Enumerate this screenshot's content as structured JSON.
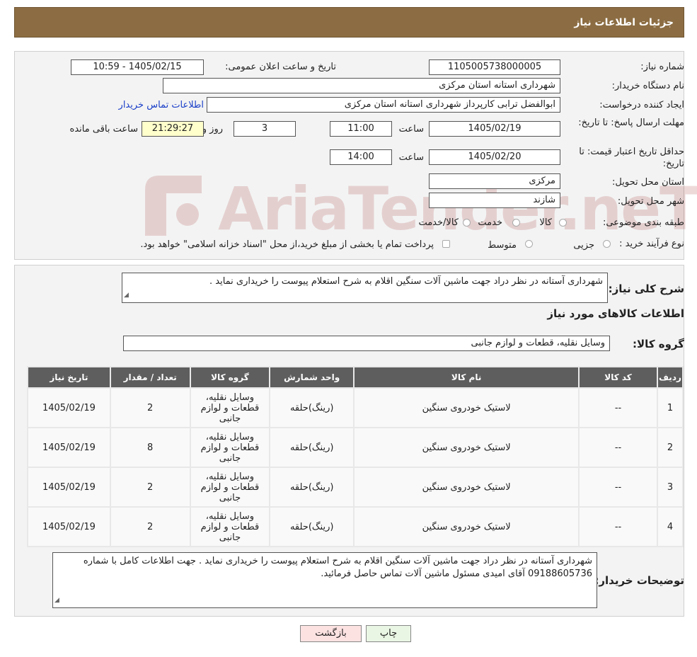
{
  "header": {
    "title": "جزئیات اطلاعات نیاز"
  },
  "form": {
    "need_number_label": "شماره نیاز:",
    "need_number": "1105005738000005",
    "announce_label": "تاریخ و ساعت اعلان عمومی:",
    "announce_value": "1405/02/15 - 10:59",
    "buyer_org_label": "نام دستگاه خریدار:",
    "buyer_org": "شهرداری استانه استان مرکزی",
    "creator_label": "ایجاد کننده درخواست:",
    "creator": "ابوالفضل  ترابی  کارپرداز  شهرداری استانه استان مرکزی",
    "contact_link": "اطلاعات تماس خریدار",
    "deadline_label": "مهلت ارسال پاسخ: تا تاریخ:",
    "deadline_date": "1405/02/19",
    "time_label": "ساعت",
    "deadline_time": "11:00",
    "days_value": "3",
    "days_label": "روز و",
    "remaining_time": "21:29:27",
    "remaining_label": "ساعت باقی مانده",
    "validity_label": "حداقل تاریخ اعتبار قیمت: تا تاریخ:",
    "validity_date": "1405/02/20",
    "validity_time": "14:00",
    "province_label": "استان محل تحویل:",
    "province": "مرکزی",
    "city_label": "شهر محل تحویل:",
    "city": "شازند",
    "category_label": "طبقه بندی موضوعی:",
    "category_options": [
      "کالا",
      "خدمت",
      "کالا/خدمت"
    ],
    "process_label": "نوع فرآیند خرید :",
    "process_options": [
      "جزیی",
      "متوسط"
    ],
    "process_note": "پرداخت تمام یا بخشی از مبلغ خرید،از محل \"اسناد خزانه اسلامی\" خواهد بود."
  },
  "summary": {
    "desc_label": "شرح کلی نیاز:",
    "desc_text": "شهرداری آستانه در نظر دراد جهت ماشین آلات سنگین اقلام به شرح استعلام پیوست را خریداری نماید .",
    "goods_info_title": "اطلاعات کالاهای مورد نیاز",
    "goods_group_label": "گروه کالا:",
    "goods_group_value": "وسایل نقلیه، قطعات و لوازم جانبی"
  },
  "table": {
    "headers": [
      "ردیف",
      "کد کالا",
      "نام کالا",
      "واحد شمارش",
      "گروه کالا",
      "تعداد / مقدار",
      "تاریخ نیاز"
    ],
    "rows": [
      [
        "1",
        "--",
        "لاستیک خودروی سنگین",
        "(رینگ)حلقه",
        "وسایل نقلیه، قطعات و لوازم جانبی",
        "2",
        "1405/02/19"
      ],
      [
        "2",
        "--",
        "لاستیک خودروی سنگین",
        "(رینگ)حلقه",
        "وسایل نقلیه، قطعات و لوازم جانبی",
        "8",
        "1405/02/19"
      ],
      [
        "3",
        "--",
        "لاستیک خودروی سنگین",
        "(رینگ)حلقه",
        "وسایل نقلیه، قطعات و لوازم جانبی",
        "2",
        "1405/02/19"
      ],
      [
        "4",
        "--",
        "لاستیک خودروی سنگین",
        "(رینگ)حلقه",
        "وسایل نقلیه، قطعات و لوازم جانبی",
        "2",
        "1405/02/19"
      ]
    ]
  },
  "buyer_notes": {
    "label": "توضیحات خریدار:",
    "text": "شهرداری آستانه در نظر دراد جهت ماشین آلات سنگین اقلام به شرح استعلام پیوست را خریداری نماید . جهت اطلاعات کامل با شماره 09188605736 آقای امیدی مسئول ماشین آلات تماس حاصل فرمائید."
  },
  "buttons": {
    "print": "چاپ",
    "back": "بازگشت"
  },
  "watermark": {
    "text": "AriaTender.neT"
  },
  "colors": {
    "header_bg": "#8c6d43",
    "table_header_bg": "#5e5e5e",
    "remaining_bg": "#ffffcc",
    "back_button_bg": "#fde2e2",
    "print_button_bg": "#eaf6e4"
  }
}
